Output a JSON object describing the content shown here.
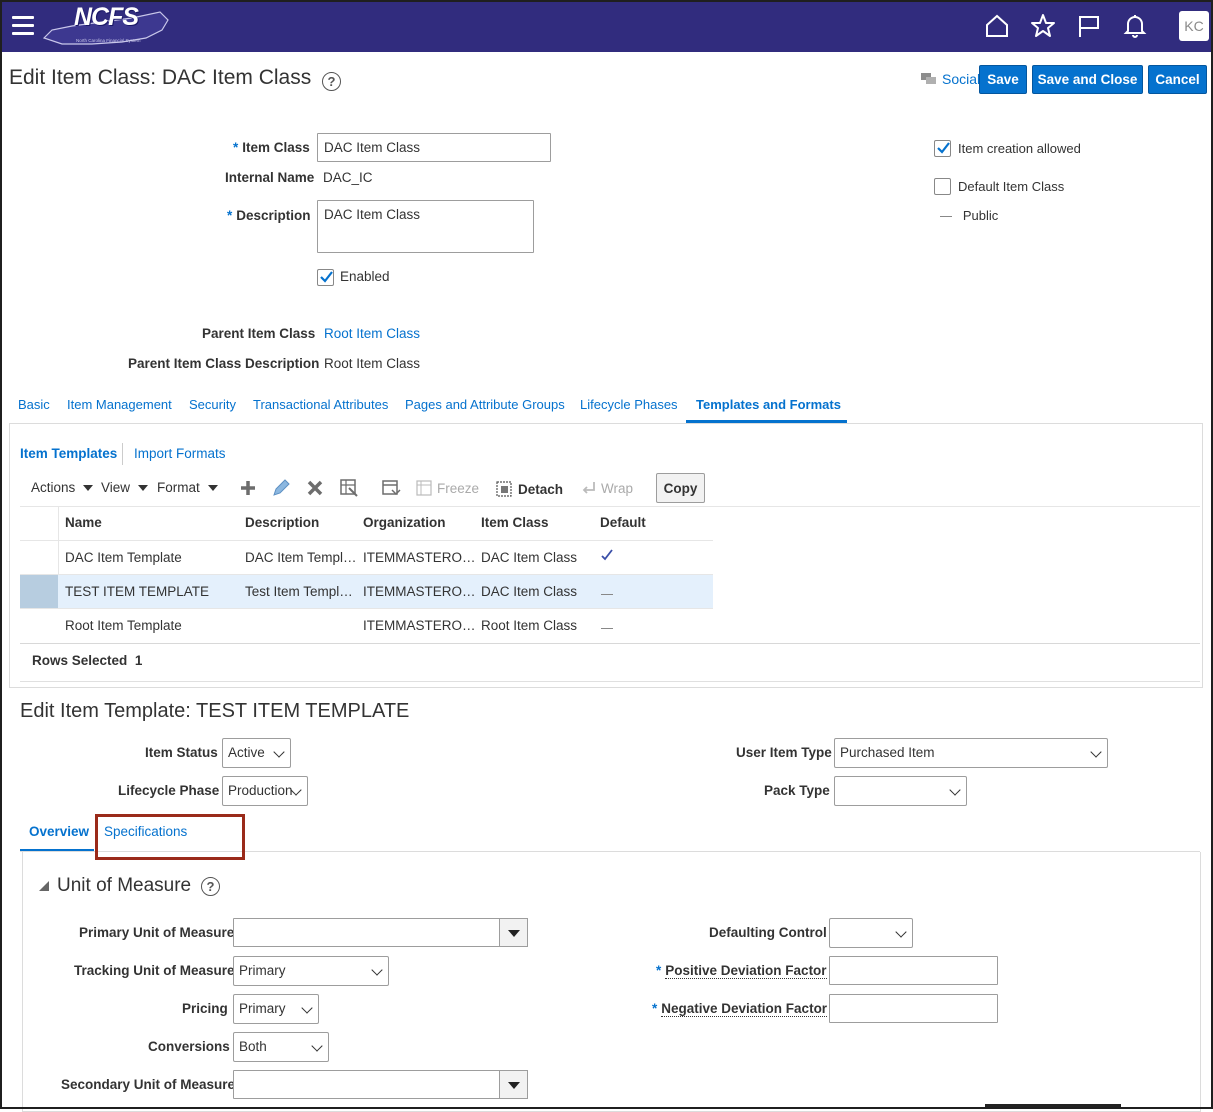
{
  "header": {
    "logo_text": "NCFS",
    "avatar_initials": "KC"
  },
  "page": {
    "title": "Edit Item Class: DAC Item Class",
    "social_label": "Social",
    "save_label": "Save",
    "save_close_label": "Save and Close",
    "cancel_label": "Cancel"
  },
  "form": {
    "item_class_label": "Item Class",
    "item_class_value": "DAC Item Class",
    "internal_name_label": "Internal Name",
    "internal_name_value": "DAC_IC",
    "description_label": "Description",
    "description_value": "DAC Item Class",
    "enabled_label": "Enabled",
    "parent_item_class_label": "Parent Item Class",
    "parent_item_class_value": "Root Item Class",
    "parent_desc_label": "Parent Item Class Description",
    "parent_desc_value": "Root Item Class",
    "item_creation_label": "Item creation allowed",
    "default_item_class_label": "Default Item Class",
    "public_label": "Public"
  },
  "tabs": [
    "Basic",
    "Item Management",
    "Security",
    "Transactional Attributes",
    "Pages and Attribute Groups",
    "Lifecycle Phases",
    "Templates and Formats"
  ],
  "subtabs": {
    "item_templates": "Item Templates",
    "import_formats": "Import Formats"
  },
  "toolbar": {
    "actions": "Actions",
    "view": "View",
    "format": "Format",
    "freeze": "Freeze",
    "detach": "Detach",
    "wrap": "Wrap",
    "copy": "Copy"
  },
  "table": {
    "headers": [
      "Name",
      "Description",
      "Organization",
      "Item Class",
      "Default"
    ],
    "rows": [
      {
        "name": "DAC Item Template",
        "description": "DAC Item Templ…",
        "organization": "ITEMMASTERO…",
        "item_class": "DAC Item Class",
        "default": true
      },
      {
        "name": "TEST ITEM TEMPLATE",
        "description": "Test Item Templ…",
        "organization": "ITEMMASTERO…",
        "item_class": "DAC Item Class",
        "default": false
      },
      {
        "name": "Root Item Template",
        "description": "",
        "organization": "ITEMMASTERO…",
        "item_class": "Root Item Class",
        "default": false
      }
    ],
    "rows_selected_label": "Rows Selected",
    "rows_selected_count": "1"
  },
  "template_edit": {
    "title": "Edit Item Template: TEST ITEM TEMPLATE",
    "item_status_label": "Item Status",
    "item_status_value": "Active",
    "lifecycle_label": "Lifecycle Phase",
    "lifecycle_value": "Production",
    "user_item_type_label": "User Item Type",
    "user_item_type_value": "Purchased Item",
    "pack_type_label": "Pack Type",
    "pack_type_value": "",
    "tab_overview": "Overview",
    "tab_specifications": "Specifications"
  },
  "uom": {
    "title": "Unit of Measure",
    "primary_label": "Primary Unit of Measure",
    "primary_value": "",
    "tracking_label": "Tracking Unit of Measure",
    "tracking_value": "Primary",
    "pricing_label": "Pricing",
    "pricing_value": "Primary",
    "conversions_label": "Conversions",
    "conversions_value": "Both",
    "secondary_label": "Secondary Unit of Measure",
    "secondary_value": "",
    "defaulting_label": "Defaulting Control",
    "positive_label": "Positive Deviation Factor",
    "negative_label": "Negative Deviation Factor"
  },
  "colors": {
    "header_bg": "#312c7e",
    "accent": "#0572ce",
    "highlight_box": "#9a2a1a",
    "selected_row": "#e4f0fc"
  }
}
